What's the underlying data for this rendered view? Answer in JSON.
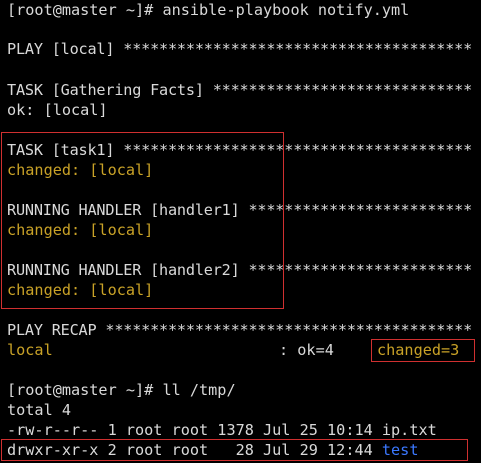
{
  "terminal": {
    "lines": {
      "cmd1": "[root@master ~]# ansible-playbook notify.yml",
      "play": "PLAY [local] ***************************************",
      "task_gather": "TASK [Gathering Facts] *****************************",
      "ok_local": "ok: [local]",
      "task1": "TASK [task1] ***************************************",
      "changed1": "changed: [local]",
      "handler1": "RUNNING HANDLER [handler1] *************************",
      "changed2": "changed: [local]",
      "handler2": "RUNNING HANDLER [handler2] *************************",
      "changed3": "changed: [local]",
      "recap": "PLAY RECAP *****************************************",
      "recap_host": "local",
      "recap_ok": ": ok=4",
      "recap_changed": "changed=3",
      "cmd2": "[root@master ~]# ll /tmp/",
      "total": "total 4",
      "file1": "-rw-r--r-- 1 root root 1378 Jul 25 10:14 ip.txt",
      "file2_prefix": "drwxr-xr-x 2 root root   28 Jul 29 12:44 ",
      "file2_name": "test"
    }
  },
  "colors": {
    "background": "#000000",
    "text": "#d9d9d9",
    "changed": "#c9a227",
    "directory": "#3b78ff",
    "highlight_box": "#d03030"
  }
}
